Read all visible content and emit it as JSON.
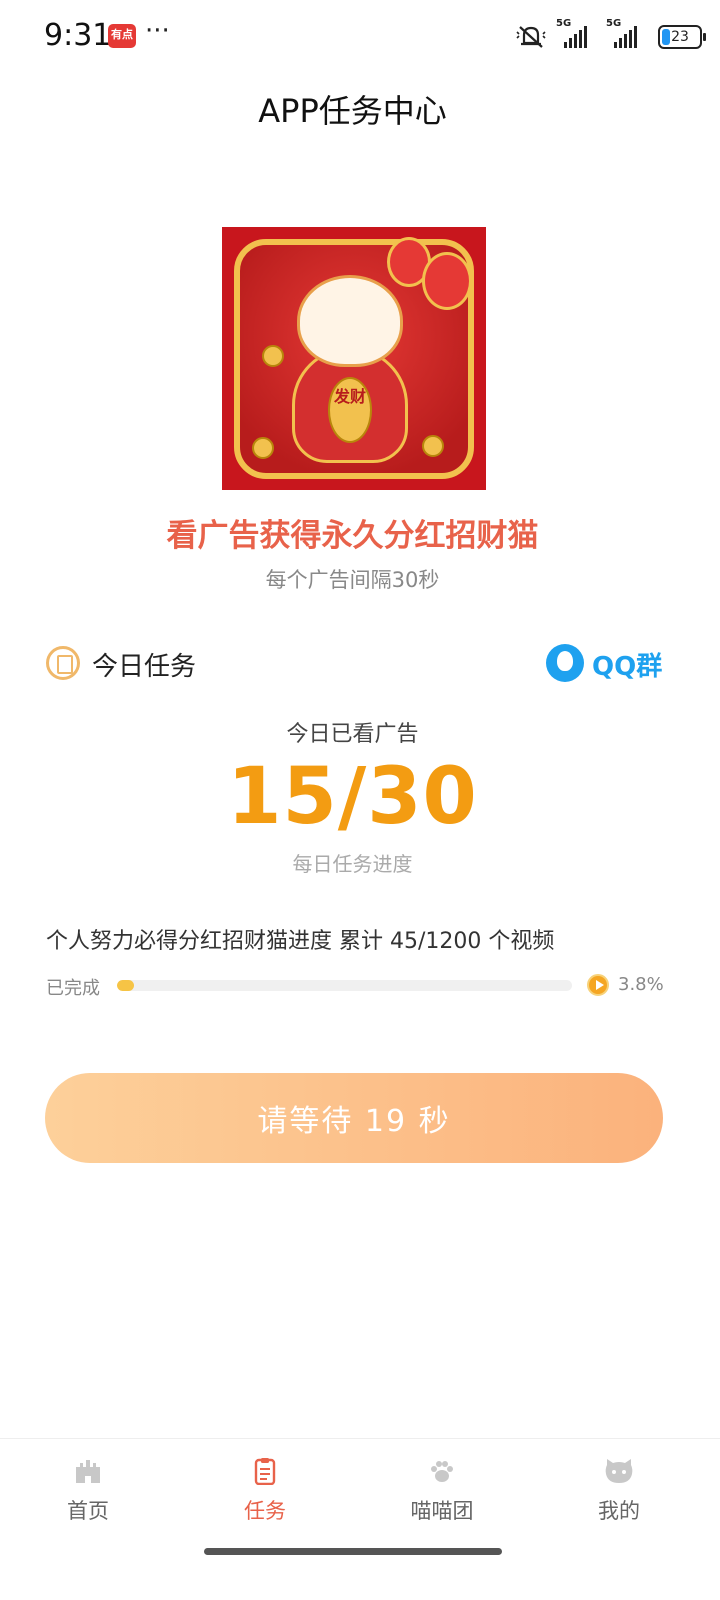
{
  "status_bar": {
    "time": "9:31",
    "app_icon_text": "有点",
    "more": "···",
    "signal_labels": [
      "5G",
      "5G"
    ],
    "battery": "23"
  },
  "header": {
    "title": "APP任务中心"
  },
  "hero": {
    "image_name": "lucky-cat-image",
    "badge_text": "发财",
    "headline": "看广告获得永久分红招财猫",
    "subline": "每个广告间隔30秒"
  },
  "tasks": {
    "title": "今日任务",
    "qq_label": "QQ群",
    "watched_label": "今日已看广告",
    "watched_count": "15/30",
    "daily_progress_label": "每日任务进度",
    "personal_progress": "个人努力必得分红招财猫进度 累计 45/1200 个视频",
    "done_label": "已完成",
    "progress_fraction": 0.038,
    "percent_text": "3.8%",
    "wait_button_label": "请等待 19 秒"
  },
  "colors": {
    "accent": "#e8624a",
    "count_orange": "#f39c12",
    "qq_blue": "#1ea1ef",
    "progress_fill": "#f6c445"
  },
  "bottom_nav": {
    "items": [
      {
        "label": "首页",
        "icon": "castle-icon",
        "active": false
      },
      {
        "label": "任务",
        "icon": "clipboard-icon",
        "active": true
      },
      {
        "label": "喵喵团",
        "icon": "paw-icon",
        "active": false
      },
      {
        "label": "我的",
        "icon": "cat-face-icon",
        "active": false
      }
    ]
  }
}
